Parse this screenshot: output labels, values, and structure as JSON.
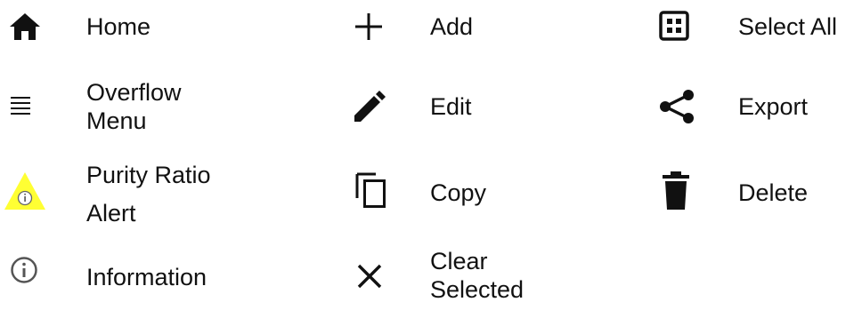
{
  "legend": {
    "items": [
      {
        "id": "home",
        "label": "Home",
        "icon": "home-icon"
      },
      {
        "id": "overflow-menu",
        "label_lines": [
          "Overflow",
          "Menu"
        ],
        "icon": "hamburger-menu-icon"
      },
      {
        "id": "purity-ratio-alert",
        "label_lines": [
          "Purity Ratio",
          "Alert"
        ],
        "icon": "warning-triangle-info-icon"
      },
      {
        "id": "information",
        "label": "Information",
        "icon": "info-circle-icon"
      },
      {
        "id": "add",
        "label": "Add",
        "icon": "plus-icon"
      },
      {
        "id": "edit",
        "label": "Edit",
        "icon": "pencil-icon"
      },
      {
        "id": "copy",
        "label": "Copy",
        "icon": "copy-icon"
      },
      {
        "id": "clear-selected",
        "label_lines": [
          "Clear",
          "Selected"
        ],
        "icon": "close-x-icon"
      },
      {
        "id": "select-all",
        "label": "Select All",
        "icon": "select-all-grid-icon"
      },
      {
        "id": "export",
        "label": "Export",
        "icon": "share-icon"
      },
      {
        "id": "delete",
        "label": "Delete",
        "icon": "trash-icon"
      }
    ]
  },
  "colors": {
    "icon": "#111111",
    "text": "#111111",
    "alert_fill": "#ffff33",
    "info_gray": "#666666"
  }
}
